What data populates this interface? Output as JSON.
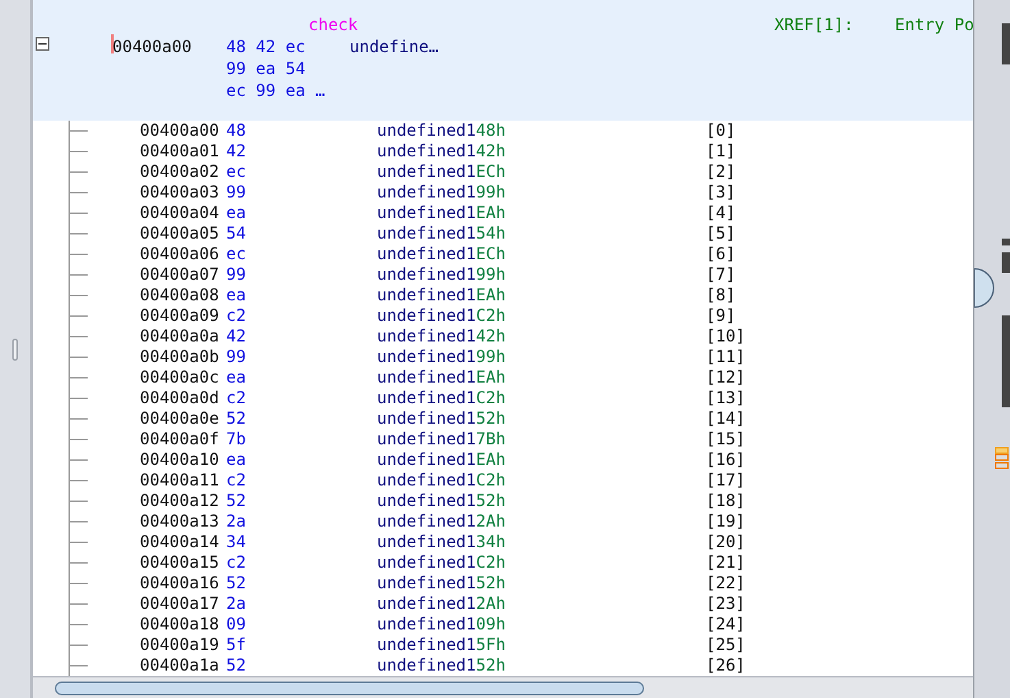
{
  "header": {
    "label": "check",
    "xref": "XREF[1]:",
    "xref_target": "Entry Po",
    "collapsed": false,
    "address": "00400a00",
    "byte_lines": [
      "48 42 ec",
      "99 ea 54",
      "ec 99 ea …"
    ],
    "type": "undefine…"
  },
  "rows": [
    {
      "address": "00400a00",
      "byte": "48",
      "type": "undefined1",
      "value": "48h",
      "index": "[0]"
    },
    {
      "address": "00400a01",
      "byte": "42",
      "type": "undefined1",
      "value": "42h",
      "index": "[1]"
    },
    {
      "address": "00400a02",
      "byte": "ec",
      "type": "undefined1",
      "value": "ECh",
      "index": "[2]"
    },
    {
      "address": "00400a03",
      "byte": "99",
      "type": "undefined1",
      "value": "99h",
      "index": "[3]"
    },
    {
      "address": "00400a04",
      "byte": "ea",
      "type": "undefined1",
      "value": "EAh",
      "index": "[4]"
    },
    {
      "address": "00400a05",
      "byte": "54",
      "type": "undefined1",
      "value": "54h",
      "index": "[5]"
    },
    {
      "address": "00400a06",
      "byte": "ec",
      "type": "undefined1",
      "value": "ECh",
      "index": "[6]"
    },
    {
      "address": "00400a07",
      "byte": "99",
      "type": "undefined1",
      "value": "99h",
      "index": "[7]"
    },
    {
      "address": "00400a08",
      "byte": "ea",
      "type": "undefined1",
      "value": "EAh",
      "index": "[8]"
    },
    {
      "address": "00400a09",
      "byte": "c2",
      "type": "undefined1",
      "value": "C2h",
      "index": "[9]"
    },
    {
      "address": "00400a0a",
      "byte": "42",
      "type": "undefined1",
      "value": "42h",
      "index": "[10]"
    },
    {
      "address": "00400a0b",
      "byte": "99",
      "type": "undefined1",
      "value": "99h",
      "index": "[11]"
    },
    {
      "address": "00400a0c",
      "byte": "ea",
      "type": "undefined1",
      "value": "EAh",
      "index": "[12]"
    },
    {
      "address": "00400a0d",
      "byte": "c2",
      "type": "undefined1",
      "value": "C2h",
      "index": "[13]"
    },
    {
      "address": "00400a0e",
      "byte": "52",
      "type": "undefined1",
      "value": "52h",
      "index": "[14]"
    },
    {
      "address": "00400a0f",
      "byte": "7b",
      "type": "undefined1",
      "value": "7Bh",
      "index": "[15]"
    },
    {
      "address": "00400a10",
      "byte": "ea",
      "type": "undefined1",
      "value": "EAh",
      "index": "[16]"
    },
    {
      "address": "00400a11",
      "byte": "c2",
      "type": "undefined1",
      "value": "C2h",
      "index": "[17]"
    },
    {
      "address": "00400a12",
      "byte": "52",
      "type": "undefined1",
      "value": "52h",
      "index": "[18]"
    },
    {
      "address": "00400a13",
      "byte": "2a",
      "type": "undefined1",
      "value": "2Ah",
      "index": "[19]"
    },
    {
      "address": "00400a14",
      "byte": "34",
      "type": "undefined1",
      "value": "34h",
      "index": "[20]"
    },
    {
      "address": "00400a15",
      "byte": "c2",
      "type": "undefined1",
      "value": "C2h",
      "index": "[21]"
    },
    {
      "address": "00400a16",
      "byte": "52",
      "type": "undefined1",
      "value": "52h",
      "index": "[22]"
    },
    {
      "address": "00400a17",
      "byte": "2a",
      "type": "undefined1",
      "value": "2Ah",
      "index": "[23]"
    },
    {
      "address": "00400a18",
      "byte": "09",
      "type": "undefined1",
      "value": "09h",
      "index": "[24]"
    },
    {
      "address": "00400a19",
      "byte": "5f",
      "type": "undefined1",
      "value": "5Fh",
      "index": "[25]"
    },
    {
      "address": "00400a1a",
      "byte": "52",
      "type": "undefined1",
      "value": "52h",
      "index": "[26]"
    }
  ]
}
